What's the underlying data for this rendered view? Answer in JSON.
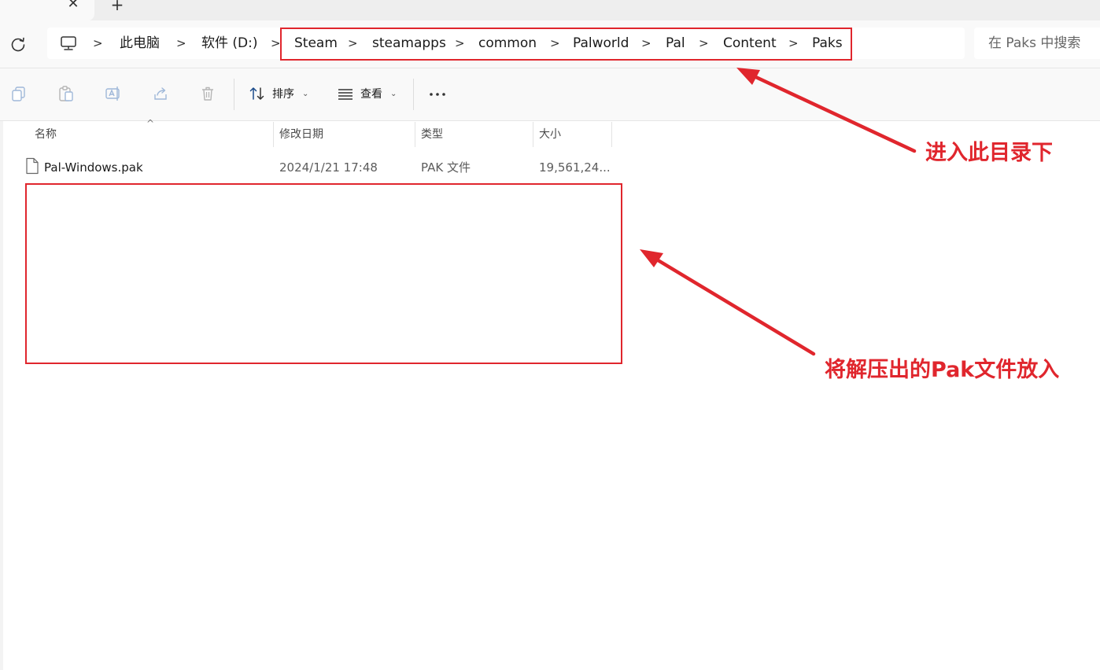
{
  "tabs": {
    "close_glyph": "✕",
    "new_glyph": "+"
  },
  "address": {
    "breadcrumbs": [
      "此电脑",
      "软件 (D:)",
      "Steam",
      "steamapps",
      "common",
      "Palworld",
      "Pal",
      "Content",
      "Paks"
    ],
    "search_placeholder": "在 Paks 中搜索"
  },
  "toolbar": {
    "sort_label": "排序",
    "view_label": "查看",
    "icons": [
      "copy-icon",
      "paste-icon",
      "rename-icon",
      "share-icon",
      "delete-icon",
      "sort-icon",
      "view-icon",
      "more-icon"
    ]
  },
  "file_list": {
    "columns": [
      "名称",
      "修改日期",
      "类型",
      "大小"
    ],
    "rows": [
      {
        "name": "Pal-Windows.pak",
        "modified": "2024/1/21 17:48",
        "type": "PAK 文件",
        "size": "19,561,24..."
      }
    ]
  },
  "annotations": {
    "enter_directory": "进入此目录下",
    "place_pak": "将解压出的Pak文件放入",
    "color": "#e0262d"
  }
}
